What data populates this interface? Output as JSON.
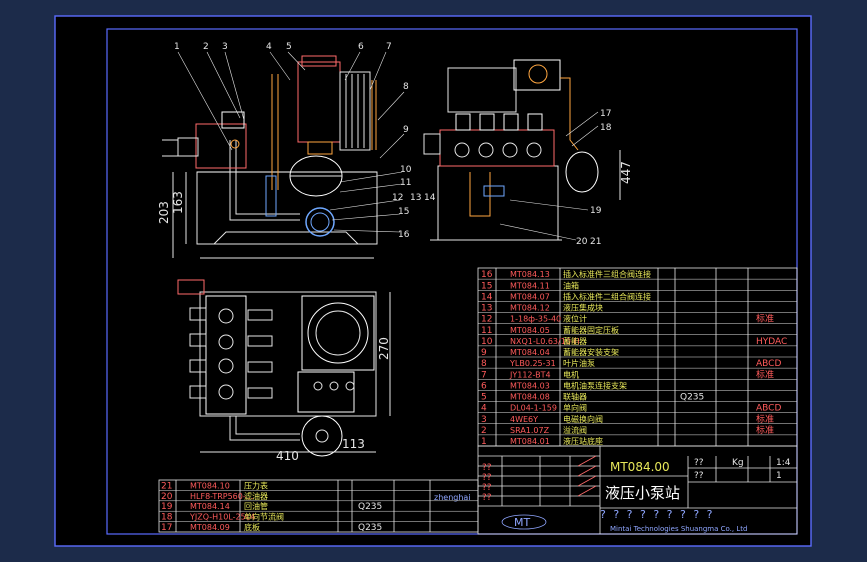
{
  "callouts_front": [
    "1",
    "2",
    "3",
    "4",
    "5",
    "6",
    "7",
    "8",
    "9",
    "10",
    "11",
    "12",
    "13",
    "14",
    "15",
    "16"
  ],
  "callouts_side": [
    "17",
    "18",
    "19",
    "20",
    "21"
  ],
  "dims": {
    "h203": "203",
    "h163": "163",
    "h447": "447",
    "w410": "410",
    "w113": "113",
    "h270": "270"
  },
  "bom_upper": [
    {
      "no": "16",
      "code": "MT084.13",
      "name": "插入标准件三组合阀连接",
      "mat": "",
      "note": ""
    },
    {
      "no": "15",
      "code": "MT084.11",
      "name": "油箱",
      "mat": "",
      "note": ""
    },
    {
      "no": "14",
      "code": "MT084.07",
      "name": "插入标准件二组合阀连接",
      "mat": "",
      "note": ""
    },
    {
      "no": "13",
      "code": "MT084.12",
      "name": "液压集成块",
      "mat": "",
      "note": ""
    },
    {
      "no": "12",
      "code": "1-18ф-35-40",
      "name": "液位计",
      "mat": "",
      "note": "标准"
    },
    {
      "no": "11",
      "code": "MT084.05",
      "name": "蓄能器固定压板",
      "mat": "",
      "note": ""
    },
    {
      "no": "10",
      "code": "NXQ1-L0.63/10-H",
      "name": "蓄能器",
      "mat": "",
      "note": "HYDAC"
    },
    {
      "no": "9",
      "code": "MT084.04",
      "name": "蓄能器安装支架",
      "mat": "",
      "note": ""
    },
    {
      "no": "8",
      "code": "YLB0.25-31",
      "name": "叶片油泵",
      "mat": "",
      "note": "ABCD"
    },
    {
      "no": "7",
      "code": "JY112-BT4",
      "name": "电机",
      "mat": "",
      "note": "标准"
    },
    {
      "no": "6",
      "code": "MT084.03",
      "name": "电机油泵连接支架",
      "mat": "",
      "note": ""
    },
    {
      "no": "5",
      "code": "MT084.08",
      "name": "联轴器",
      "mat": "Q235",
      "note": ""
    },
    {
      "no": "4",
      "code": "DL04-1-159",
      "name": "单向阀",
      "mat": "",
      "note": "ABCD"
    },
    {
      "no": "3",
      "code": "4WE6Y",
      "name": "电磁换向阀",
      "mat": "",
      "note": "标准"
    },
    {
      "no": "2",
      "code": "SRA1.07Z",
      "name": "溢流阀",
      "mat": "",
      "note": "标准"
    },
    {
      "no": "1",
      "code": "MT084.01",
      "name": "液压站底座",
      "mat": "",
      "note": ""
    }
  ],
  "bom_lower": [
    {
      "no": "21",
      "code": "MT084.10",
      "name": "压力表",
      "mat": "",
      "note": ""
    },
    {
      "no": "20",
      "code": "HLF8-TRP560-...",
      "name": "滤油器",
      "mat": "",
      "note": ""
    },
    {
      "no": "19",
      "code": "MT084.14",
      "name": "回油管",
      "mat": "Q235",
      "note": ""
    },
    {
      "no": "18",
      "code": "YJZQ-H10L-25L4",
      "name": "单向节流阀",
      "mat": "",
      "note": ""
    },
    {
      "no": "17",
      "code": "MT084.09",
      "name": "底板",
      "mat": "Q235",
      "note": ""
    }
  ],
  "title_block": {
    "drawing_no": "MT084.00",
    "title": "液压小泵站",
    "company": "Mintai Technologies Shuangma Co., Ltd",
    "logo": "MT",
    "qs": "? ? ? ? ? ? ? ? ?",
    "material_q235": "Q235",
    "sig": "zhenghai",
    "scale": "1:4",
    "kg": "Kg",
    "one": "1",
    "qq": "??"
  }
}
